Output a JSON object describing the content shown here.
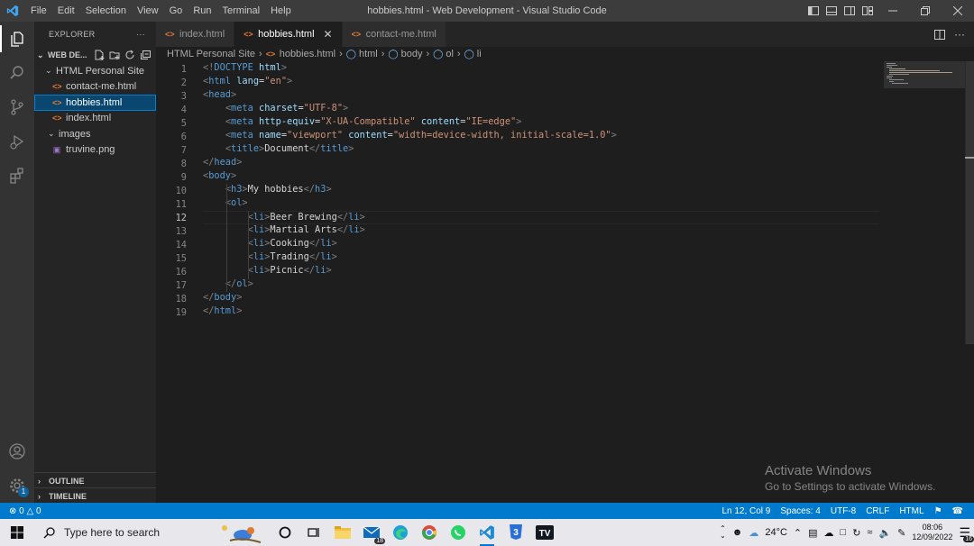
{
  "titlebar": {
    "menu": [
      "File",
      "Edit",
      "Selection",
      "View",
      "Go",
      "Run",
      "Terminal",
      "Help"
    ],
    "title": "hobbies.html - Web Development - Visual Studio Code"
  },
  "sidebar": {
    "title": "EXPLORER",
    "more": "···",
    "workspace": "WEB DE...",
    "folder": "HTML Personal Site",
    "files": [
      {
        "name": "contact-me.html",
        "icon": "<>"
      },
      {
        "name": "hobbies.html",
        "icon": "<>"
      },
      {
        "name": "index.html",
        "icon": "<>"
      }
    ],
    "images_folder": "images",
    "image_file": "truvine.png",
    "outline": "OUTLINE",
    "timeline": "TIMELINE"
  },
  "tabs": [
    {
      "label": "index.html",
      "active": false
    },
    {
      "label": "hobbies.html",
      "active": true
    },
    {
      "label": "contact-me.html",
      "active": false
    }
  ],
  "breadcrumb": [
    "HTML Personal Site",
    "hobbies.html",
    "html",
    "body",
    "ol",
    "li"
  ],
  "editor": {
    "current_line": 12,
    "line_numbers": [
      "1",
      "2",
      "3",
      "4",
      "5",
      "6",
      "7",
      "8",
      "9",
      "10",
      "11",
      "12",
      "13",
      "14",
      "15",
      "16",
      "17",
      "18",
      "19"
    ]
  },
  "watermark": {
    "title": "Activate Windows",
    "subtitle": "Go to Settings to activate Windows."
  },
  "statusbar": {
    "errors": "0",
    "warnings": "0",
    "position": "Ln 12, Col 9",
    "spaces": "Spaces: 4",
    "encoding": "UTF-8",
    "eol": "CRLF",
    "language": "HTML"
  },
  "taskbar": {
    "search_placeholder": "Type here to search",
    "mail_badge": "18",
    "weather": "24°C",
    "time": "08:06",
    "date": "12/09/2022",
    "notifications": "16"
  },
  "accounts_badge": "1",
  "colors": {
    "accent": "#007acc",
    "html_icon": "#e37933",
    "tag": "#569cd6",
    "attr": "#9cdcfe",
    "string": "#ce9178"
  }
}
